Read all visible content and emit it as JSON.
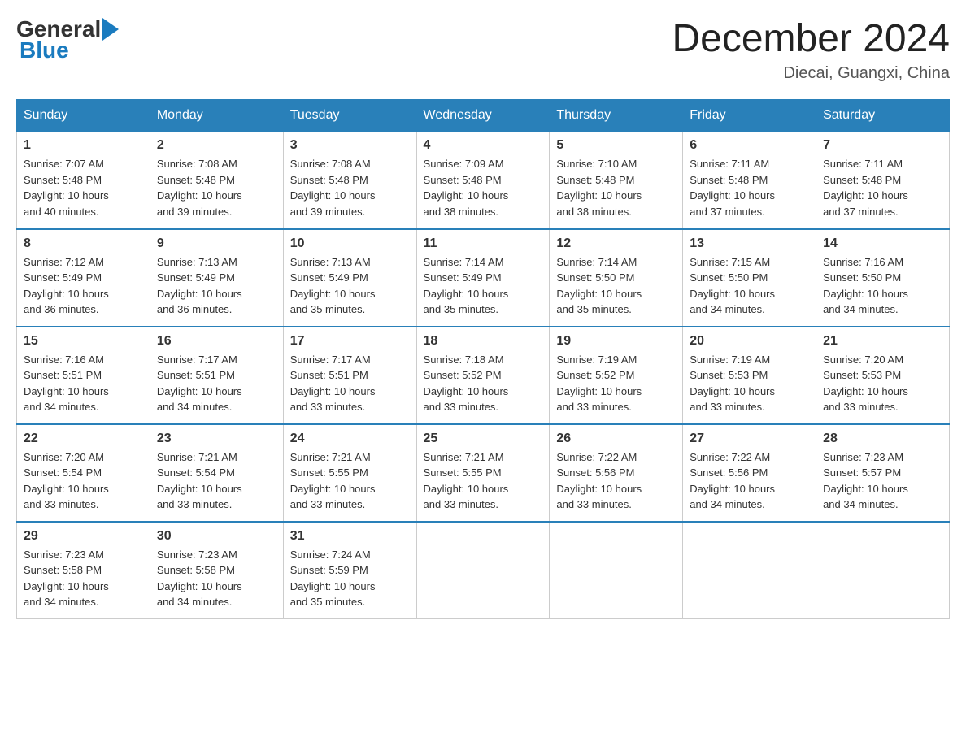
{
  "logo": {
    "general": "General",
    "blue": "Blue"
  },
  "header": {
    "title": "December 2024",
    "location": "Diecai, Guangxi, China"
  },
  "weekdays": [
    "Sunday",
    "Monday",
    "Tuesday",
    "Wednesday",
    "Thursday",
    "Friday",
    "Saturday"
  ],
  "weeks": [
    [
      {
        "day": "1",
        "sunrise": "7:07 AM",
        "sunset": "5:48 PM",
        "daylight": "10 hours and 40 minutes."
      },
      {
        "day": "2",
        "sunrise": "7:08 AM",
        "sunset": "5:48 PM",
        "daylight": "10 hours and 39 minutes."
      },
      {
        "day": "3",
        "sunrise": "7:08 AM",
        "sunset": "5:48 PM",
        "daylight": "10 hours and 39 minutes."
      },
      {
        "day": "4",
        "sunrise": "7:09 AM",
        "sunset": "5:48 PM",
        "daylight": "10 hours and 38 minutes."
      },
      {
        "day": "5",
        "sunrise": "7:10 AM",
        "sunset": "5:48 PM",
        "daylight": "10 hours and 38 minutes."
      },
      {
        "day": "6",
        "sunrise": "7:11 AM",
        "sunset": "5:48 PM",
        "daylight": "10 hours and 37 minutes."
      },
      {
        "day": "7",
        "sunrise": "7:11 AM",
        "sunset": "5:48 PM",
        "daylight": "10 hours and 37 minutes."
      }
    ],
    [
      {
        "day": "8",
        "sunrise": "7:12 AM",
        "sunset": "5:49 PM",
        "daylight": "10 hours and 36 minutes."
      },
      {
        "day": "9",
        "sunrise": "7:13 AM",
        "sunset": "5:49 PM",
        "daylight": "10 hours and 36 minutes."
      },
      {
        "day": "10",
        "sunrise": "7:13 AM",
        "sunset": "5:49 PM",
        "daylight": "10 hours and 35 minutes."
      },
      {
        "day": "11",
        "sunrise": "7:14 AM",
        "sunset": "5:49 PM",
        "daylight": "10 hours and 35 minutes."
      },
      {
        "day": "12",
        "sunrise": "7:14 AM",
        "sunset": "5:50 PM",
        "daylight": "10 hours and 35 minutes."
      },
      {
        "day": "13",
        "sunrise": "7:15 AM",
        "sunset": "5:50 PM",
        "daylight": "10 hours and 34 minutes."
      },
      {
        "day": "14",
        "sunrise": "7:16 AM",
        "sunset": "5:50 PM",
        "daylight": "10 hours and 34 minutes."
      }
    ],
    [
      {
        "day": "15",
        "sunrise": "7:16 AM",
        "sunset": "5:51 PM",
        "daylight": "10 hours and 34 minutes."
      },
      {
        "day": "16",
        "sunrise": "7:17 AM",
        "sunset": "5:51 PM",
        "daylight": "10 hours and 34 minutes."
      },
      {
        "day": "17",
        "sunrise": "7:17 AM",
        "sunset": "5:51 PM",
        "daylight": "10 hours and 33 minutes."
      },
      {
        "day": "18",
        "sunrise": "7:18 AM",
        "sunset": "5:52 PM",
        "daylight": "10 hours and 33 minutes."
      },
      {
        "day": "19",
        "sunrise": "7:19 AM",
        "sunset": "5:52 PM",
        "daylight": "10 hours and 33 minutes."
      },
      {
        "day": "20",
        "sunrise": "7:19 AM",
        "sunset": "5:53 PM",
        "daylight": "10 hours and 33 minutes."
      },
      {
        "day": "21",
        "sunrise": "7:20 AM",
        "sunset": "5:53 PM",
        "daylight": "10 hours and 33 minutes."
      }
    ],
    [
      {
        "day": "22",
        "sunrise": "7:20 AM",
        "sunset": "5:54 PM",
        "daylight": "10 hours and 33 minutes."
      },
      {
        "day": "23",
        "sunrise": "7:21 AM",
        "sunset": "5:54 PM",
        "daylight": "10 hours and 33 minutes."
      },
      {
        "day": "24",
        "sunrise": "7:21 AM",
        "sunset": "5:55 PM",
        "daylight": "10 hours and 33 minutes."
      },
      {
        "day": "25",
        "sunrise": "7:21 AM",
        "sunset": "5:55 PM",
        "daylight": "10 hours and 33 minutes."
      },
      {
        "day": "26",
        "sunrise": "7:22 AM",
        "sunset": "5:56 PM",
        "daylight": "10 hours and 33 minutes."
      },
      {
        "day": "27",
        "sunrise": "7:22 AM",
        "sunset": "5:56 PM",
        "daylight": "10 hours and 34 minutes."
      },
      {
        "day": "28",
        "sunrise": "7:23 AM",
        "sunset": "5:57 PM",
        "daylight": "10 hours and 34 minutes."
      }
    ],
    [
      {
        "day": "29",
        "sunrise": "7:23 AM",
        "sunset": "5:58 PM",
        "daylight": "10 hours and 34 minutes."
      },
      {
        "day": "30",
        "sunrise": "7:23 AM",
        "sunset": "5:58 PM",
        "daylight": "10 hours and 34 minutes."
      },
      {
        "day": "31",
        "sunrise": "7:24 AM",
        "sunset": "5:59 PM",
        "daylight": "10 hours and 35 minutes."
      },
      null,
      null,
      null,
      null
    ]
  ],
  "labels": {
    "sunrise": "Sunrise:",
    "sunset": "Sunset:",
    "daylight": "Daylight:"
  }
}
